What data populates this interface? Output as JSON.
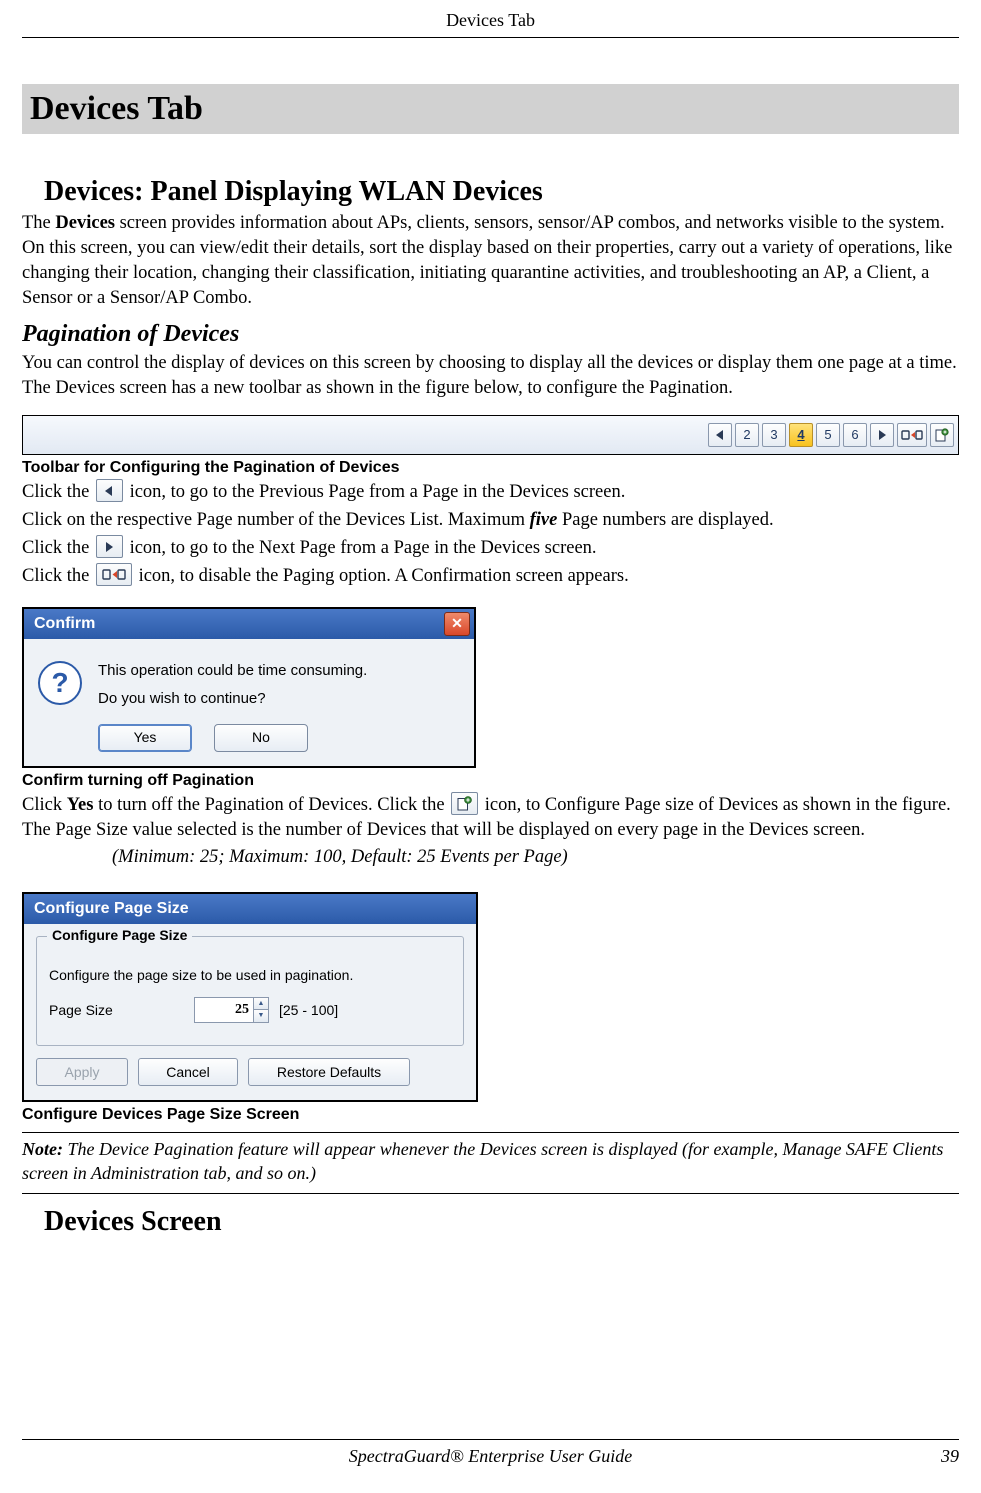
{
  "running_head": "Devices Tab",
  "h1": "Devices Tab",
  "h2_a": "Devices: Panel Displaying WLAN Devices",
  "intro_prefix": "The ",
  "intro_bold": "Devices",
  "intro_rest": " screen provides information about APs, clients, sensors, sensor/AP combos, and networks visible to the system. On this screen, you can view/edit their details, sort the display based on their properties, carry out a variety of operations, like changing their location, changing their classification, initiating quarantine activities, and troubleshooting an AP, a Client, a Sensor or a Sensor/AP Combo.",
  "h3": "Pagination of Devices",
  "pag_para": "You can control the display of devices on this screen by choosing to display all the devices or display them one page at a time. The Devices screen has a new toolbar as shown in the figure below, to configure the Pagination.",
  "pager": {
    "pages": [
      "2",
      "3",
      "4",
      "5",
      "6"
    ],
    "active_index": 2
  },
  "caption_toolbar": "Toolbar for Configuring the Pagination of Devices",
  "line_prev_a": "Click the ",
  "line_prev_b": " icon, to go to the Previous Page from a Page in the Devices screen.",
  "line_pagenum_a": "Click on the respective Page number of the Devices List. Maximum ",
  "line_pagenum_ital": "five",
  "line_pagenum_b": " Page numbers are displayed.",
  "line_next_a": "Click the ",
  "line_next_b": " icon, to go to the Next Page from a Page in the Devices screen.",
  "line_disable_a": "Click the ",
  "line_disable_b": " icon, to disable the Paging option. A Confirmation screen appears.",
  "confirm": {
    "title": "Confirm",
    "line1": "This operation could be time consuming.",
    "line2": "Do you wish to continue?",
    "yes": "Yes",
    "no": "No"
  },
  "caption_confirm": "Confirm turning off Pagination",
  "after_confirm_a": "Click ",
  "after_confirm_bold": "Yes",
  "after_confirm_b": " to turn off the Pagination of Devices. Click the ",
  "after_confirm_c": " icon, to Configure Page size of Devices as shown in the figure. The Page Size value selected is the number of Devices that will be displayed on every page in the Devices screen.",
  "minmax": "(Minimum: 25; Maximum: 100, Default: 25 Events per Page)",
  "cfg": {
    "title": "Configure Page Size",
    "legend": "Configure Page Size",
    "desc": "Configure the page size to be used in pagination.",
    "label": "Page Size",
    "value": "25",
    "range": "[25 - 100]",
    "apply": "Apply",
    "cancel": "Cancel",
    "restore": "Restore Defaults"
  },
  "caption_cfg": "Configure Devices Page Size Screen",
  "note_label": "Note:",
  "note_body": " The Device Pagination feature will appear whenever the Devices screen is displayed (for example, Manage SAFE Clients screen in Administration tab, and so on.)",
  "h2_b": "Devices Screen",
  "footer_title": "SpectraGuard® Enterprise User Guide",
  "page_number": "39"
}
